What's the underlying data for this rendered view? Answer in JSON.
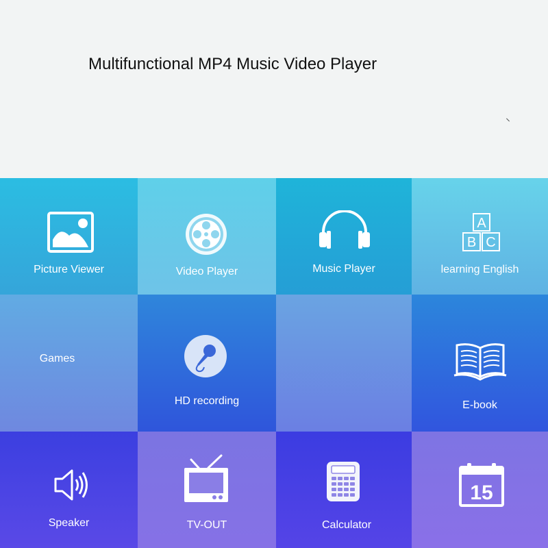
{
  "header": {
    "title": "Multifunctional MP4 Music Video Player"
  },
  "tiles": [
    {
      "label": "Picture Viewer",
      "icon": "picture-icon"
    },
    {
      "label": "Video Player",
      "icon": "film-reel-icon"
    },
    {
      "label": "Music Player",
      "icon": "headphones-icon"
    },
    {
      "label": "learning English",
      "icon": "abc-blocks-icon"
    },
    {
      "label": "Games",
      "icon": ""
    },
    {
      "label": "HD recording",
      "icon": "microphone-icon"
    },
    {
      "label": "",
      "icon": ""
    },
    {
      "label": "E-book",
      "icon": "open-book-icon"
    },
    {
      "label": "Speaker",
      "icon": "speaker-icon"
    },
    {
      "label": "TV-OUT",
      "icon": "tv-icon"
    },
    {
      "label": "Calculator",
      "icon": "calculator-icon"
    },
    {
      "label": "",
      "icon": "calendar-icon",
      "calendar_day": "15"
    }
  ],
  "colors": {
    "header_bg": "#f2f4f4",
    "icon_white": "#ffffff",
    "grid_top": "#25b5d8",
    "grid_bottom": "#6a5ae6"
  }
}
